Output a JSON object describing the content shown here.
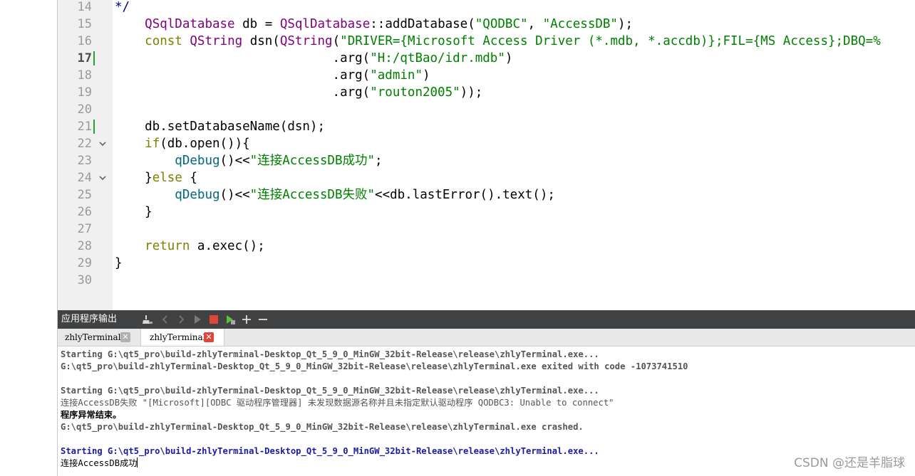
{
  "editor": {
    "lines": [
      {
        "num": "14",
        "tokens": [
          {
            "t": "*/",
            "c": "cm"
          }
        ]
      },
      {
        "num": "15",
        "tokens": [
          {
            "t": "    "
          },
          {
            "t": "QSqlDatabase",
            "c": "ty"
          },
          {
            "t": " db = "
          },
          {
            "t": "QSqlDatabase",
            "c": "ty"
          },
          {
            "t": "::addDatabase("
          },
          {
            "t": "\"QODBC\"",
            "c": "str"
          },
          {
            "t": ", "
          },
          {
            "t": "\"AccessDB\"",
            "c": "str"
          },
          {
            "t": ");"
          }
        ]
      },
      {
        "num": "16",
        "tokens": [
          {
            "t": "    "
          },
          {
            "t": "const",
            "c": "kw"
          },
          {
            "t": " "
          },
          {
            "t": "QString",
            "c": "ty"
          },
          {
            "t": " dsn("
          },
          {
            "t": "QString",
            "c": "ty"
          },
          {
            "t": "("
          },
          {
            "t": "\"DRIVER={Microsoft Access Driver (*.mdb, *.accdb)};FIL={MS Access};DBQ=%",
            "c": "str"
          }
        ]
      },
      {
        "num": "17",
        "current": true,
        "modified": true,
        "tokens": [
          {
            "t": "                             .arg("
          },
          {
            "t": "\"H:/qtBao/idr.mdb\"",
            "c": "str"
          },
          {
            "t": ")"
          }
        ]
      },
      {
        "num": "18",
        "tokens": [
          {
            "t": "                             .arg("
          },
          {
            "t": "\"admin\"",
            "c": "str"
          },
          {
            "t": ")"
          }
        ]
      },
      {
        "num": "19",
        "tokens": [
          {
            "t": "                             .arg("
          },
          {
            "t": "\"routon2005\"",
            "c": "str"
          },
          {
            "t": "));"
          }
        ]
      },
      {
        "num": "20",
        "tokens": []
      },
      {
        "num": "21",
        "modified": true,
        "tokens": [
          {
            "t": "    db.setDatabaseName(dsn);"
          }
        ]
      },
      {
        "num": "22",
        "fold": true,
        "tokens": [
          {
            "t": "    "
          },
          {
            "t": "if",
            "c": "kw"
          },
          {
            "t": "(db.open()){"
          }
        ]
      },
      {
        "num": "23",
        "tokens": [
          {
            "t": "        "
          },
          {
            "t": "qDebug",
            "c": "fn"
          },
          {
            "t": "()<<"
          },
          {
            "t": "\"连接AccessDB成功\"",
            "c": "str"
          },
          {
            "t": ";"
          }
        ]
      },
      {
        "num": "24",
        "fold": true,
        "tokens": [
          {
            "t": "    }"
          },
          {
            "t": "else",
            "c": "kw"
          },
          {
            "t": " {"
          }
        ]
      },
      {
        "num": "25",
        "tokens": [
          {
            "t": "        "
          },
          {
            "t": "qDebug",
            "c": "fn"
          },
          {
            "t": "()<<"
          },
          {
            "t": "\"连接AccessDB失败\"",
            "c": "str"
          },
          {
            "t": "<<db.lastError().text();"
          }
        ]
      },
      {
        "num": "26",
        "tokens": [
          {
            "t": "    }"
          }
        ]
      },
      {
        "num": "27",
        "tokens": []
      },
      {
        "num": "28",
        "tokens": [
          {
            "t": "    "
          },
          {
            "t": "return",
            "c": "kw"
          },
          {
            "t": " a.exec();"
          }
        ]
      },
      {
        "num": "29",
        "tokens": [
          {
            "t": "}"
          }
        ]
      },
      {
        "num": "30",
        "tokens": []
      }
    ]
  },
  "output_pane": {
    "title": "应用程序输出",
    "tabs": [
      {
        "label": "zhlyTerminal",
        "active": false
      },
      {
        "label": "zhlyTerminal",
        "active": true
      }
    ],
    "lines": [
      {
        "text": "Starting G:\\qt5_pro\\build-zhlyTerminal-Desktop_Qt_5_9_0_MinGW_32bit-Release\\release\\zhlyTerminal.exe...",
        "style": "bold"
      },
      {
        "text": "G:\\qt5_pro\\build-zhlyTerminal-Desktop_Qt_5_9_0_MinGW_32bit-Release\\release\\zhlyTerminal.exe exited with code -1073741510",
        "style": "bold"
      },
      {
        "text": "",
        "style": ""
      },
      {
        "text": "Starting G:\\qt5_pro\\build-zhlyTerminal-Desktop_Qt_5_9_0_MinGW_32bit-Release\\release\\zhlyTerminal.exe...",
        "style": "bold"
      },
      {
        "text": "连接AccessDB失败 \"[Microsoft][ODBC 驱动程序管理器] 未发现数据源名称并且未指定默认驱动程序 QODBC3: Unable to connect\"",
        "style": ""
      },
      {
        "text": "程序异常结束。",
        "style": "bold dark"
      },
      {
        "text": "G:\\qt5_pro\\build-zhlyTerminal-Desktop_Qt_5_9_0_MinGW_32bit-Release\\release\\zhlyTerminal.exe crashed.",
        "style": "bold"
      },
      {
        "text": "",
        "style": ""
      },
      {
        "text": "Starting G:\\qt5_pro\\build-zhlyTerminal-Desktop_Qt_5_9_0_MinGW_32bit-Release\\release\\zhlyTerminal.exe...",
        "style": "blue"
      },
      {
        "text": "连接AccessDB成功",
        "style": "dark",
        "cursor": true
      }
    ]
  },
  "watermark": "CSDN @还是羊脂球",
  "colors": {
    "keyword": "#808000",
    "type": "#800080",
    "string": "#008000",
    "function": "#00677c",
    "comment": "#000080",
    "output_bar": "#404244",
    "close_red": "#e0453a"
  }
}
